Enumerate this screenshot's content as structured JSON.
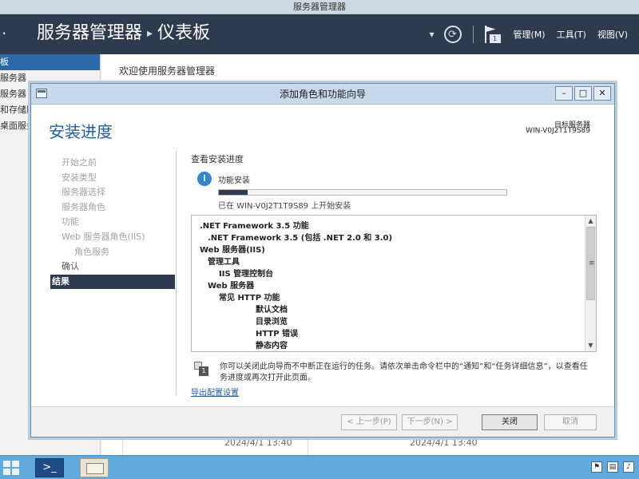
{
  "window": {
    "title": "服务器管理器"
  },
  "header": {
    "back_glyph": "·",
    "title": "服务器管理器",
    "separator": "▸",
    "page": "仪表板",
    "notification_count": "1",
    "menu": [
      "管理(M)",
      "工具(T)",
      "视图(V)"
    ]
  },
  "nav": {
    "items": [
      "板",
      "服务器",
      "服务器",
      "和存储服",
      "桌面服务"
    ]
  },
  "main": {
    "welcome": "欢迎使用服务器管理器",
    "timestamps": [
      "2024/4/1 13:40",
      "2024/4/1 13:40"
    ]
  },
  "wizard": {
    "title": "添加角色和功能向导",
    "heading": "安装进度",
    "destination_label": "目标服务器",
    "destination_value": "WIN-V0J2T1T9S89",
    "steps": [
      {
        "label": "开始之前",
        "state": "disabled",
        "sub": false
      },
      {
        "label": "安装类型",
        "state": "disabled",
        "sub": false
      },
      {
        "label": "服务器选择",
        "state": "disabled",
        "sub": false
      },
      {
        "label": "服务器角色",
        "state": "disabled",
        "sub": false
      },
      {
        "label": "功能",
        "state": "disabled",
        "sub": false
      },
      {
        "label": "Web 服务器角色(IIS)",
        "state": "disabled",
        "sub": false
      },
      {
        "label": "角色服务",
        "state": "disabled",
        "sub": true
      },
      {
        "label": "确认",
        "state": "done",
        "sub": false
      },
      {
        "label": "结果",
        "state": "current",
        "sub": false
      }
    ],
    "section_title": "查看安装进度",
    "feature_install_label": "功能安装",
    "progress_fraction": 0.1,
    "progress_text": "已在 WIN-V0J2T1T9S89 上开始安装",
    "features": [
      {
        "text": ".NET Framework 3.5 功能",
        "level": 0
      },
      {
        "text": ".NET Framework 3.5 (包括 .NET 2.0 和 3.0)",
        "level": 1
      },
      {
        "text": "Web 服务器(IIS)",
        "level": 0
      },
      {
        "text": "管理工具",
        "level": 1
      },
      {
        "text": "IIS 管理控制台",
        "level": 2
      },
      {
        "text": "Web 服务器",
        "level": 1
      },
      {
        "text": "常见 HTTP 功能",
        "level": 2
      },
      {
        "text": "默认文档",
        "level": 3
      },
      {
        "text": "目录浏览",
        "level": 3
      },
      {
        "text": "HTTP 错误",
        "level": 3
      },
      {
        "text": "静态内容",
        "level": 3
      }
    ],
    "note": "你可以关闭此向导而不中断正在运行的任务。请依次单击命令栏中的“通知”和“任务详细信息”，以查看任务进度或再次打开此页面。",
    "export_link": "导出配置设置",
    "buttons": {
      "previous": "< 上一步(P)",
      "next": "下一步(N) >",
      "close": "关闭",
      "cancel": "取消"
    }
  }
}
